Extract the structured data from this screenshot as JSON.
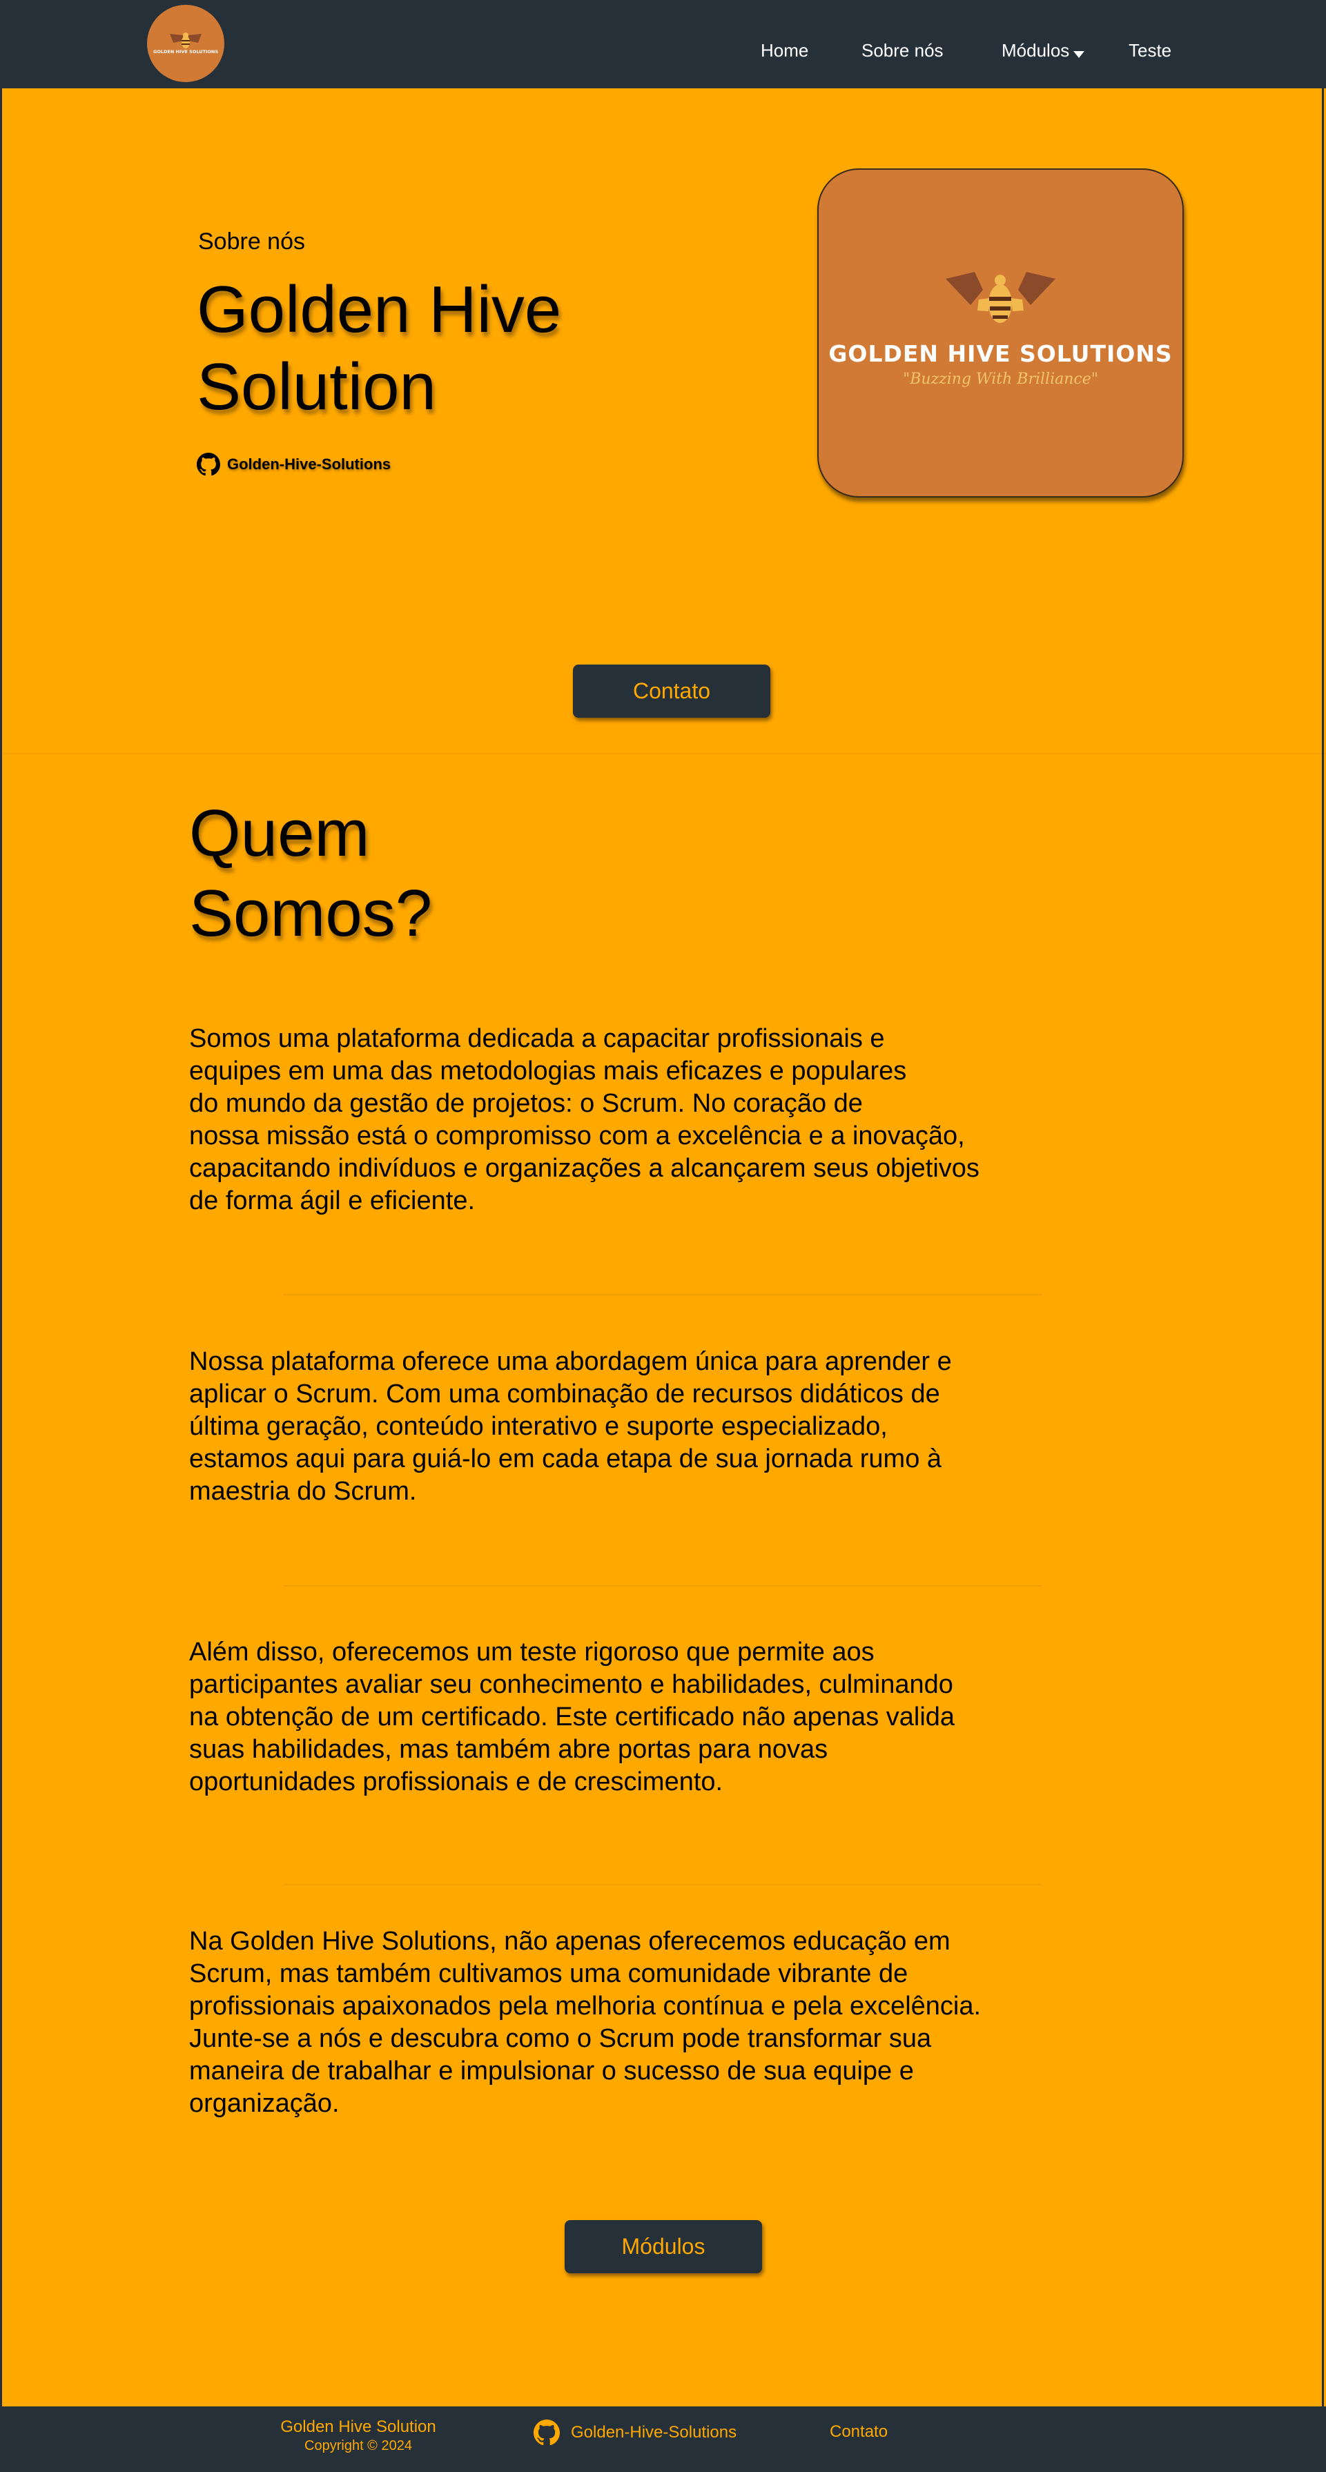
{
  "nav": {
    "logo_text": "GOLDEN HIVE SOLUTIONS",
    "items": [
      {
        "label": "Home"
      },
      {
        "label": "Sobre nós"
      },
      {
        "label": "Módulos"
      },
      {
        "label": "Teste"
      }
    ]
  },
  "hero": {
    "eyebrow": "Sobre nós",
    "title_line1": "Golden Hive",
    "title_line2": "Solution",
    "github_label": "Golden-Hive-Solutions",
    "card_title": "GOLDEN HIVE SOLUTIONS",
    "card_tagline": "\"Buzzing With Brilliance\"",
    "contact_button": "Contato"
  },
  "about": {
    "title_line1": "Quem",
    "title_line2": "Somos?",
    "paragraphs": [
      [
        "Somos uma plataforma dedicada a capacitar profissionais e",
        "equipes em uma das metodologias mais eficazes e populares",
        "do mundo da gestão de projetos: o Scrum. No coração de",
        "nossa missão está o compromisso com a excelência e a inovação,",
        "capacitando indivíduos e organizações a alcançarem seus objetivos",
        "de forma ágil e eficiente."
      ],
      [
        "Nossa plataforma oferece uma abordagem única para aprender e",
        "aplicar o Scrum. Com uma combinação de recursos didáticos de",
        "última geração, conteúdo interativo e suporte especializado,",
        "estamos aqui para guiá-lo em cada etapa de sua jornada rumo à",
        "maestria do Scrum."
      ],
      [
        "Além disso, oferecemos um teste rigoroso que permite aos",
        "participantes avaliar seu conhecimento e habilidades, culminando",
        "na obtenção de um certificado. Este certificado não apenas valida",
        "suas habilidades, mas também abre portas para novas",
        "oportunidades profissionais e de crescimento."
      ],
      [
        "Na Golden Hive Solutions, não apenas oferecemos educação em",
        "Scrum, mas também cultivamos uma comunidade vibrante de",
        "profissionais apaixonados pela melhoria contínua e pela excelência.",
        "Junte-se a nós e descubra como o Scrum pode transformar sua",
        "maneira de trabalhar e impulsionar o sucesso de sua equipe e",
        "organização."
      ]
    ],
    "modules_button": "Módulos"
  },
  "footer": {
    "brand": "Golden Hive Solution",
    "copyright": "Copyright © 2024",
    "github_label": "Golden-Hive-Solutions",
    "contact": "Contato"
  },
  "colors": {
    "background": "#ffa800",
    "dark": "#263038",
    "logo": "#d07a36",
    "accent_text": "#ffa800"
  },
  "icons": [
    "bee-icon",
    "github-icon",
    "caret-down-icon"
  ]
}
